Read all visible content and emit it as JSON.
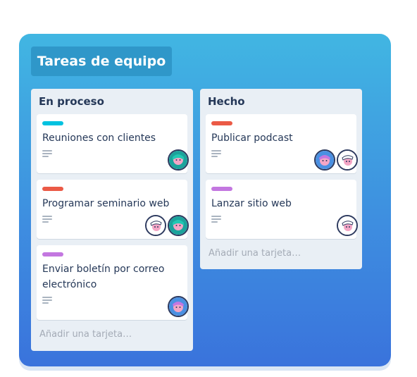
{
  "board": {
    "title": "Tareas de equipo"
  },
  "lists": [
    {
      "title": "En proceso",
      "add_card": "Añadir una tarjeta…",
      "cards": [
        {
          "label_color": "#00c2e0",
          "title": "Reuniones con clientes",
          "avatars": [
            "teal-avatar"
          ]
        },
        {
          "label_color": "#eb5a46",
          "title": "Programar seminario web",
          "avatars": [
            "white-avatar",
            "teal-avatar"
          ]
        },
        {
          "label_color": "#c377e0",
          "title": "Enviar boletín por correo electrónico",
          "avatars": [
            "blue-avatar"
          ]
        }
      ]
    },
    {
      "title": "Hecho",
      "add_card": "Añadir una tarjeta…",
      "cards": [
        {
          "label_color": "#eb5a46",
          "title": "Publicar podcast",
          "avatars": [
            "blue-avatar",
            "white-avatar"
          ]
        },
        {
          "label_color": "#c377e0",
          "title": "Lanzar sitio web",
          "avatars": [
            "white-avatar"
          ]
        }
      ]
    }
  ]
}
